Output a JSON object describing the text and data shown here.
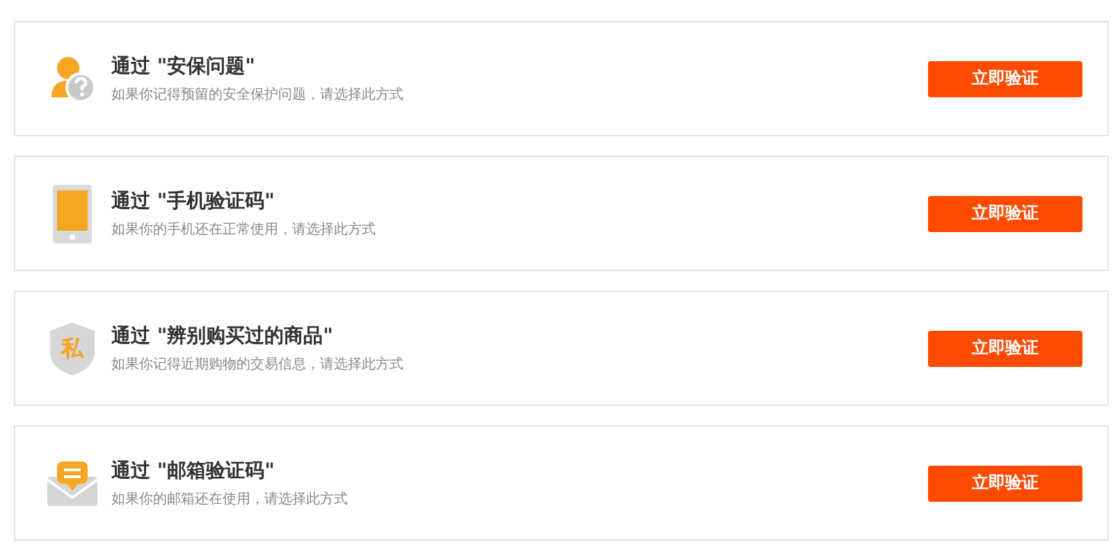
{
  "methods": [
    {
      "kind": "question",
      "title": "通过 \"安保问题\"",
      "description": "如果你记得预留的安全保护问题，请选择此方式",
      "button": "立即验证"
    },
    {
      "kind": "phone",
      "title": "通过 \"手机验证码\"",
      "description": "如果你的手机还在正常使用，请选择此方式",
      "button": "立即验证"
    },
    {
      "kind": "shield",
      "icon_text": "私",
      "title": "通过 \"辨别购买过的商品\"",
      "description": "如果你记得近期购物的交易信息，请选择此方式",
      "button": "立即验证"
    },
    {
      "kind": "mail",
      "title": "通过 \"邮箱验证码\"",
      "description": "如果你的邮箱还在使用，请选择此方式",
      "button": "立即验证"
    }
  ]
}
